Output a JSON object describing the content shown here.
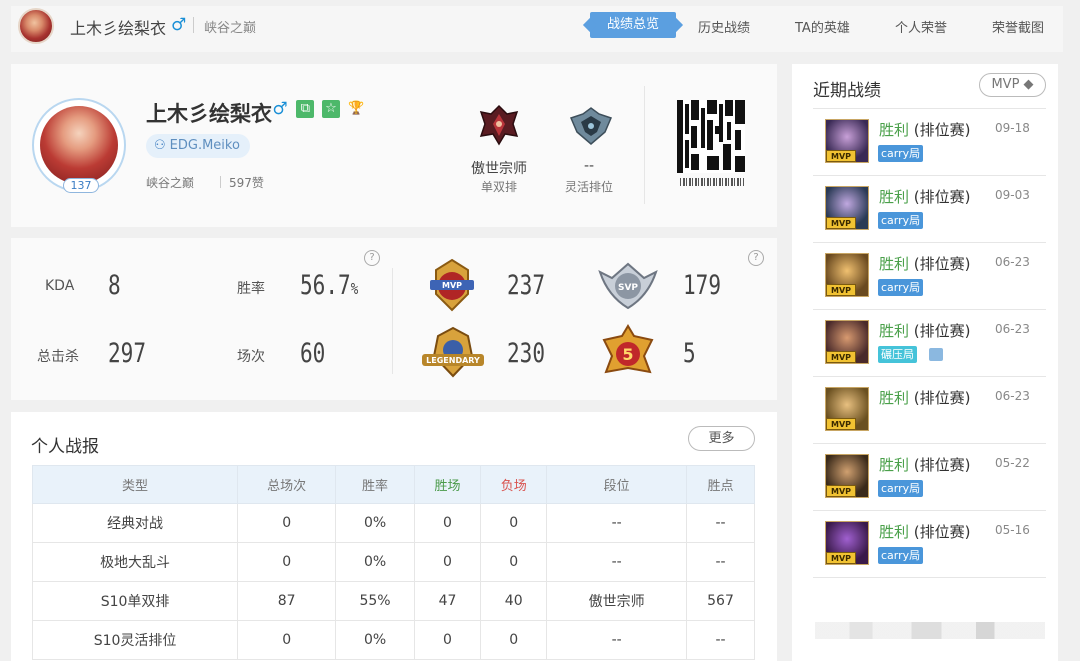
{
  "topbar": {
    "username": "上木彡绘梨衣",
    "gender_symbol": "♂",
    "region": "峡谷之巅",
    "nav": [
      {
        "label": "战绩总览",
        "active": true
      },
      {
        "label": "历史战绩",
        "active": false
      },
      {
        "label": "TA的英雄",
        "active": false
      },
      {
        "label": "个人荣誉",
        "active": false
      },
      {
        "label": "荣誉截图",
        "active": false
      }
    ]
  },
  "profile": {
    "name": "上木彡绘梨衣",
    "gender_symbol": "♂",
    "level": "137",
    "team": "EDG.Meiko",
    "region": "峡谷之巅",
    "likes": "597赞",
    "solo_rank": {
      "tier": "傲世宗师",
      "queue": "单双排"
    },
    "flex_rank": {
      "tier": "--",
      "queue": "灵活排位"
    }
  },
  "stats": {
    "kda_label": "KDA",
    "kda": "8",
    "winrate_label": "胜率",
    "winrate": "56.7",
    "winrate_unit": "%",
    "kills_label": "总击杀",
    "kills": "297",
    "games_label": "场次",
    "games": "60",
    "badges": [
      {
        "icon": "mvp-badge-icon",
        "value": "237"
      },
      {
        "icon": "svp-badge-icon",
        "value": "179"
      },
      {
        "icon": "legendary-badge-icon",
        "value": "230"
      },
      {
        "icon": "pentakill-badge-icon",
        "value": "5"
      }
    ],
    "help": "?"
  },
  "report": {
    "title": "个人战报",
    "more_label": "更多",
    "columns": [
      "类型",
      "总场次",
      "胜率",
      "胜场",
      "负场",
      "段位",
      "胜点"
    ],
    "rows": [
      [
        "经典对战",
        "0",
        "0%",
        "0",
        "0",
        "--",
        "--"
      ],
      [
        "极地大乱斗",
        "0",
        "0%",
        "0",
        "0",
        "--",
        "--"
      ],
      [
        "S10单双排",
        "87",
        "55%",
        "47",
        "40",
        "傲世宗师",
        "567"
      ],
      [
        "S10灵活排位",
        "0",
        "0%",
        "0",
        "0",
        "--",
        "--"
      ]
    ]
  },
  "recent": {
    "title": "近期战绩",
    "filter": "MVP",
    "items": [
      {
        "result": "胜利",
        "mode": "(排位赛)",
        "date": "09-18",
        "tag": "carry局",
        "tag_color": "#4a96da",
        "badge": "MVP"
      },
      {
        "result": "胜利",
        "mode": "(排位赛)",
        "date": "09-03",
        "tag": "carry局",
        "tag_color": "#4a96da",
        "badge": "MVP"
      },
      {
        "result": "胜利",
        "mode": "(排位赛)",
        "date": "06-23",
        "tag": "carry局",
        "tag_color": "#4a96da",
        "badge": "MVP"
      },
      {
        "result": "胜利",
        "mode": "(排位赛)",
        "date": "06-23",
        "tag": "碾压局",
        "tag_color": "#45c3d9",
        "badge": "MVP"
      },
      {
        "result": "胜利",
        "mode": "(排位赛)",
        "date": "06-23",
        "tag": "",
        "tag_color": "",
        "badge": "MVP"
      },
      {
        "result": "胜利",
        "mode": "(排位赛)",
        "date": "05-22",
        "tag": "carry局",
        "tag_color": "#4a96da",
        "badge": "MVP"
      },
      {
        "result": "胜利",
        "mode": "(排位赛)",
        "date": "05-16",
        "tag": "carry局",
        "tag_color": "#4a96da",
        "badge": "MVP"
      }
    ]
  },
  "colors": {
    "accent": "#5b9fe0",
    "win": "#4aa04a",
    "lose": "#d9534f",
    "mvp_gold": "#f1c232"
  }
}
